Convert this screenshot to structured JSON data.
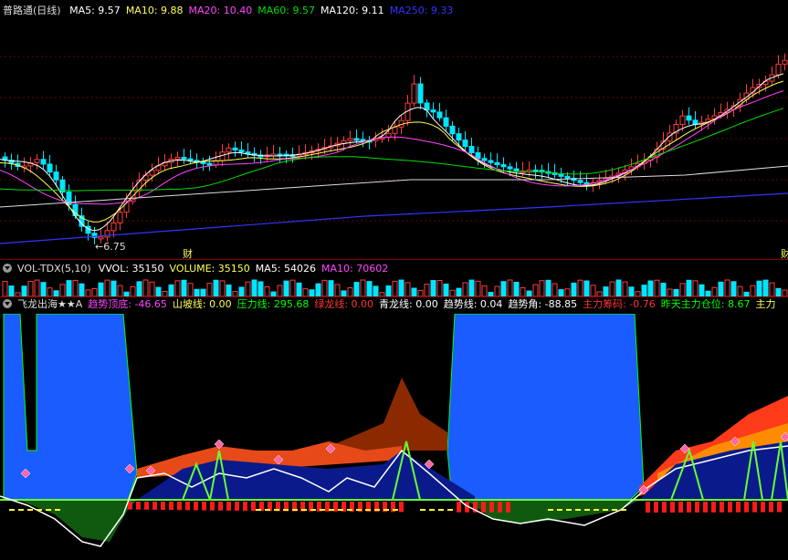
{
  "colors": {
    "bg": "#000000",
    "up": "#ff3b3b",
    "down": "#00e5ff",
    "ma5": "#ffffff",
    "ma10": "#ffff55",
    "ma20": "#ff44ff",
    "ma60": "#00dd00",
    "ma120": "#ffffff",
    "ma250": "#3333ff",
    "grid": "#7a0000",
    "vol_up": "#ff3b3b",
    "vol_down": "#00e5ff"
  },
  "main": {
    "title": "普路通(日线)",
    "ma": [
      {
        "label": "MA5: 9.57",
        "color": "#ffffff"
      },
      {
        "label": "MA10: 9.88",
        "color": "#ffff55"
      },
      {
        "label": "MA20: 10.40",
        "color": "#ff44ff"
      },
      {
        "label": "MA60: 9.57",
        "color": "#00dd00"
      },
      {
        "label": "MA120: 9.11",
        "color": "#ffffff"
      },
      {
        "label": "MA250: 9.33",
        "color": "#3333ff"
      }
    ],
    "low_label": "6.75",
    "marker_cai": "财",
    "marker_right": "财"
  },
  "vol": {
    "title": "VOL-TDX(5,10)",
    "items": [
      {
        "label": "VVOL: 35150",
        "color": "#ffffff"
      },
      {
        "label": "VOLUME: 35150",
        "color": "#ffff55"
      },
      {
        "label": "MA5: 54026",
        "color": "#ffffff"
      },
      {
        "label": "MA10: 70602",
        "color": "#ff44ff"
      }
    ]
  },
  "ind": {
    "title": "飞龙出海★★A",
    "items": [
      {
        "label": "趋势顶底: -46.65",
        "color": "#ff44ff"
      },
      {
        "label": "山坡线: 0.00",
        "color": "#ffff55"
      },
      {
        "label": "压力线: 295.68",
        "color": "#00ff00"
      },
      {
        "label": "绿龙线: 0.00",
        "color": "#ff3333"
      },
      {
        "label": "青龙线: 0.00",
        "color": "#ffffff"
      },
      {
        "label": "趋势线: 0.04",
        "color": "#ffffff"
      },
      {
        "label": "趋势角: -88.85",
        "color": "#ffffff"
      },
      {
        "label": "主力筹码: -0.76",
        "color": "#ff3333"
      },
      {
        "label": "昨天主力仓位: 8.67",
        "color": "#00ff00"
      },
      {
        "label": "主力",
        "color": "#ffff55"
      }
    ]
  }
}
